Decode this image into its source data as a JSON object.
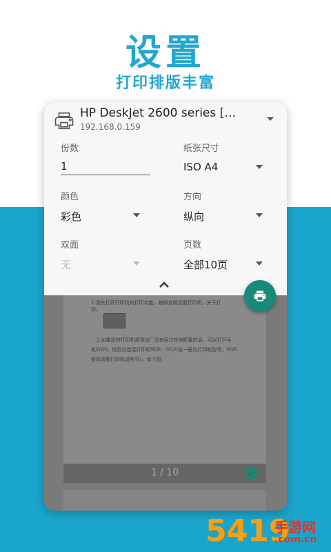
{
  "hero": {
    "title": "设置",
    "subtitle": "打印排版丰富"
  },
  "printer": {
    "name": "HP DeskJet 2600 series […",
    "ip": "192.168.0.159"
  },
  "settings": {
    "copies": {
      "label": "份数",
      "value": "1"
    },
    "paper_size": {
      "label": "纸张尺寸",
      "value": "ISO A4"
    },
    "color": {
      "label": "颜色",
      "value": "彩色"
    },
    "orientation": {
      "label": "方向",
      "value": "纵向"
    },
    "duplex": {
      "label": "双面",
      "value": "无"
    },
    "pages": {
      "label": "页数",
      "value": "全部10页"
    }
  },
  "preview": {
    "lines": [
      "1.请先打开打印机的打印功能，按照说明设置打印机，关于打",
      "印，",
      "2.如果您的打印机是预出厂没有经过任何配置的话，可以打开手",
      "机WiFi，找到并连接打印机WiFi（WiFi名一般为打印机型号，WiFi",
      "密码请看打印机说明书）。如下图："
    ],
    "page_indicator": "1 / 10"
  },
  "watermark": {
    "number": "5419",
    "text": "手游网",
    "domain": ".com.cn"
  },
  "colors": {
    "accent": "#22a7cf",
    "background_band": "#1aa6cc",
    "fab": "#178a7a",
    "check": "#1a8a6e"
  },
  "icons": {
    "printer": "printer-icon",
    "dropdown": "chevron-down-icon",
    "collapse": "chevron-up-icon",
    "fab": "print-icon",
    "selected": "check-circle-icon"
  }
}
